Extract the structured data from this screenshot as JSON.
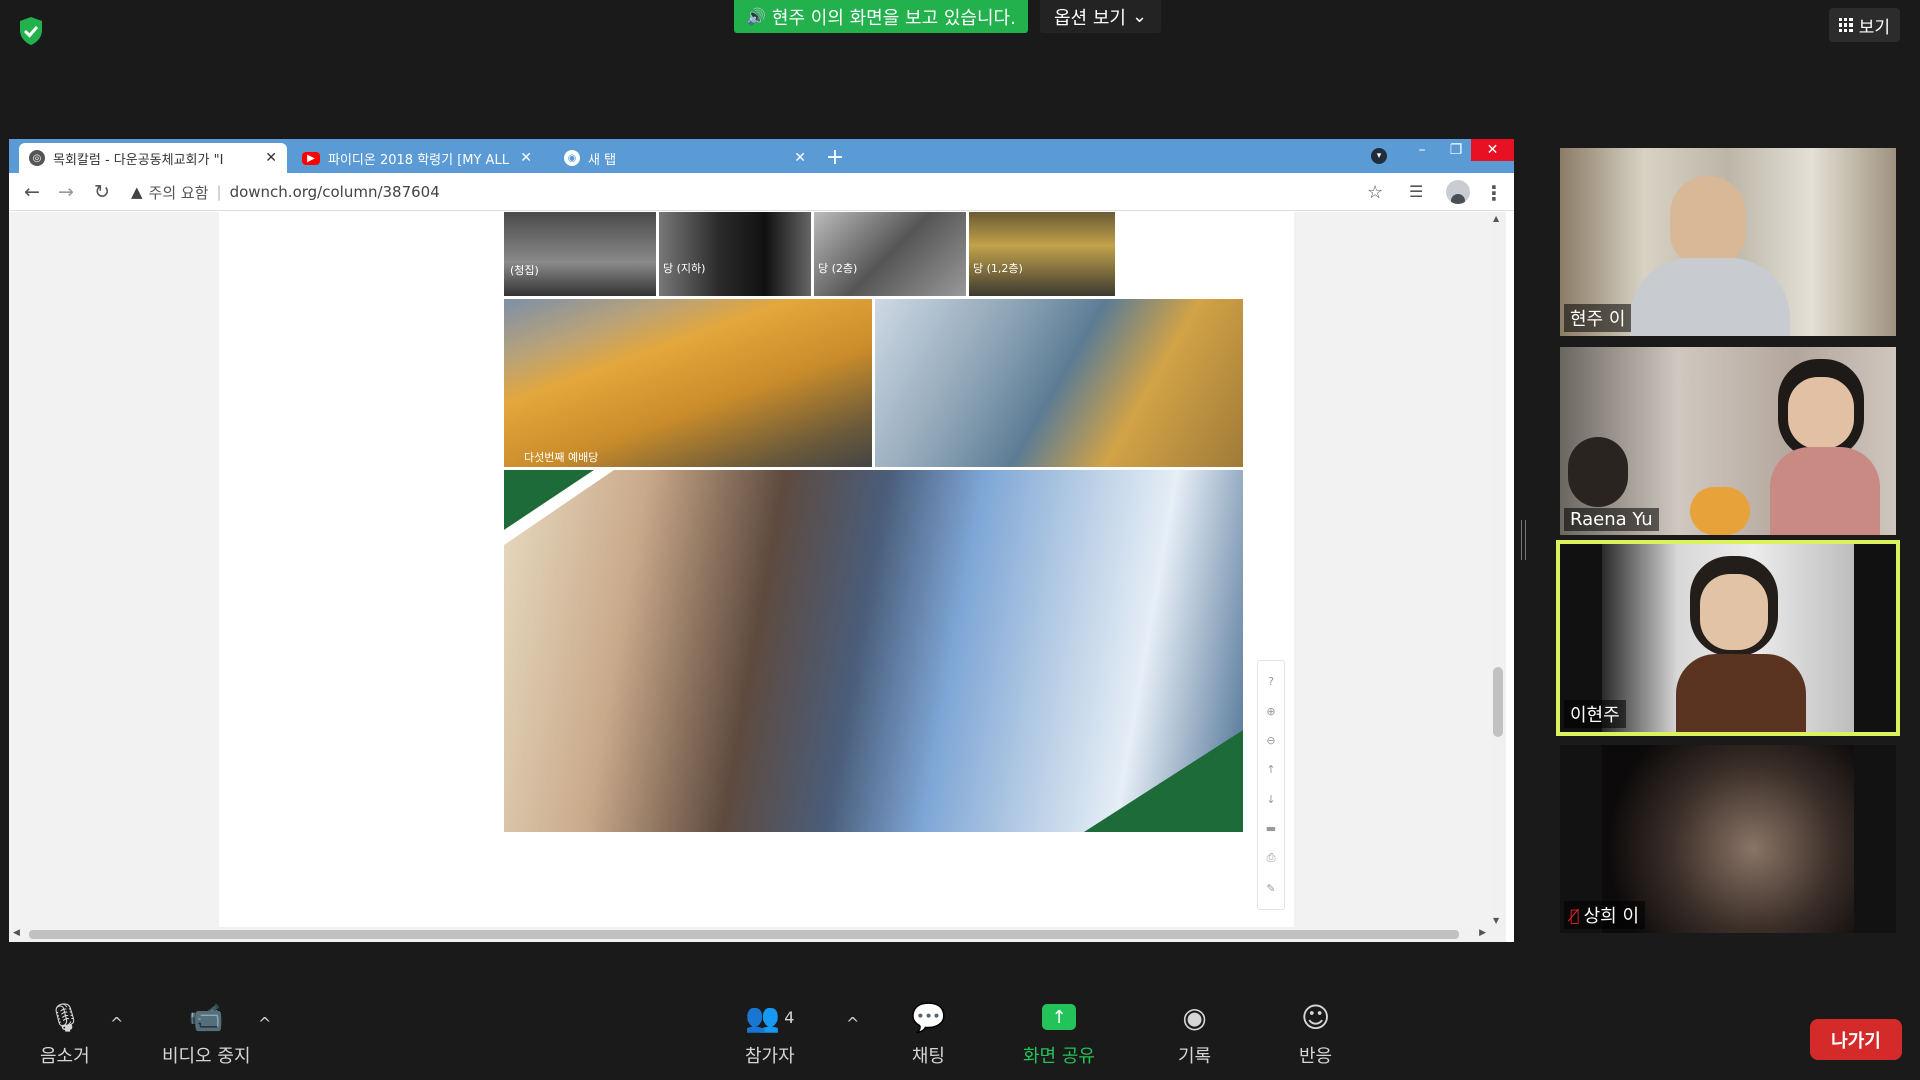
{
  "zoom": {
    "share_banner": "현주 이의 화면을 보고 있습니다.",
    "view_options": "옵션 보기",
    "gallery_label": "보기",
    "leave": "나가기"
  },
  "browser": {
    "tabs": [
      {
        "title": "목회칼럼 - 다운공동체교회가 \"I"
      },
      {
        "title": "파이디온 2018 학령기 [MY ALL"
      },
      {
        "title": "새 탭"
      }
    ],
    "new_tab": "+",
    "address": {
      "warning": "주의 요함",
      "separator": "|",
      "url": "downch.org/column/387604"
    }
  },
  "photos": {
    "cap1": "(청집)",
    "cap2": "당 (지하)",
    "cap3": "당 (2층)",
    "cap4": "당 (1,2층)",
    "cap5": "다섯번째 예배당"
  },
  "pdf_tools": [
    "?",
    "⊕",
    "⊖",
    "↑",
    "↓",
    "▬",
    "⎙",
    "✎"
  ],
  "participants": [
    {
      "name": "현주 이",
      "muted": false
    },
    {
      "name": "Raena Yu",
      "muted": false
    },
    {
      "name": "이현주",
      "muted": false,
      "active": true
    },
    {
      "name": "상희 이",
      "muted": true
    }
  ],
  "controls": {
    "mute": "음소거",
    "stop_video": "비디오 중지",
    "participants": "참가자",
    "participant_count": "4",
    "chat": "채팅",
    "share_screen": "화면 공유",
    "record": "기록",
    "reactions": "반응"
  },
  "colors": {
    "share_green": "#23b14d",
    "active_speaker": "#dcf25c",
    "leave_red": "#d42a2a",
    "tab_bar": "#5a9bd5"
  }
}
